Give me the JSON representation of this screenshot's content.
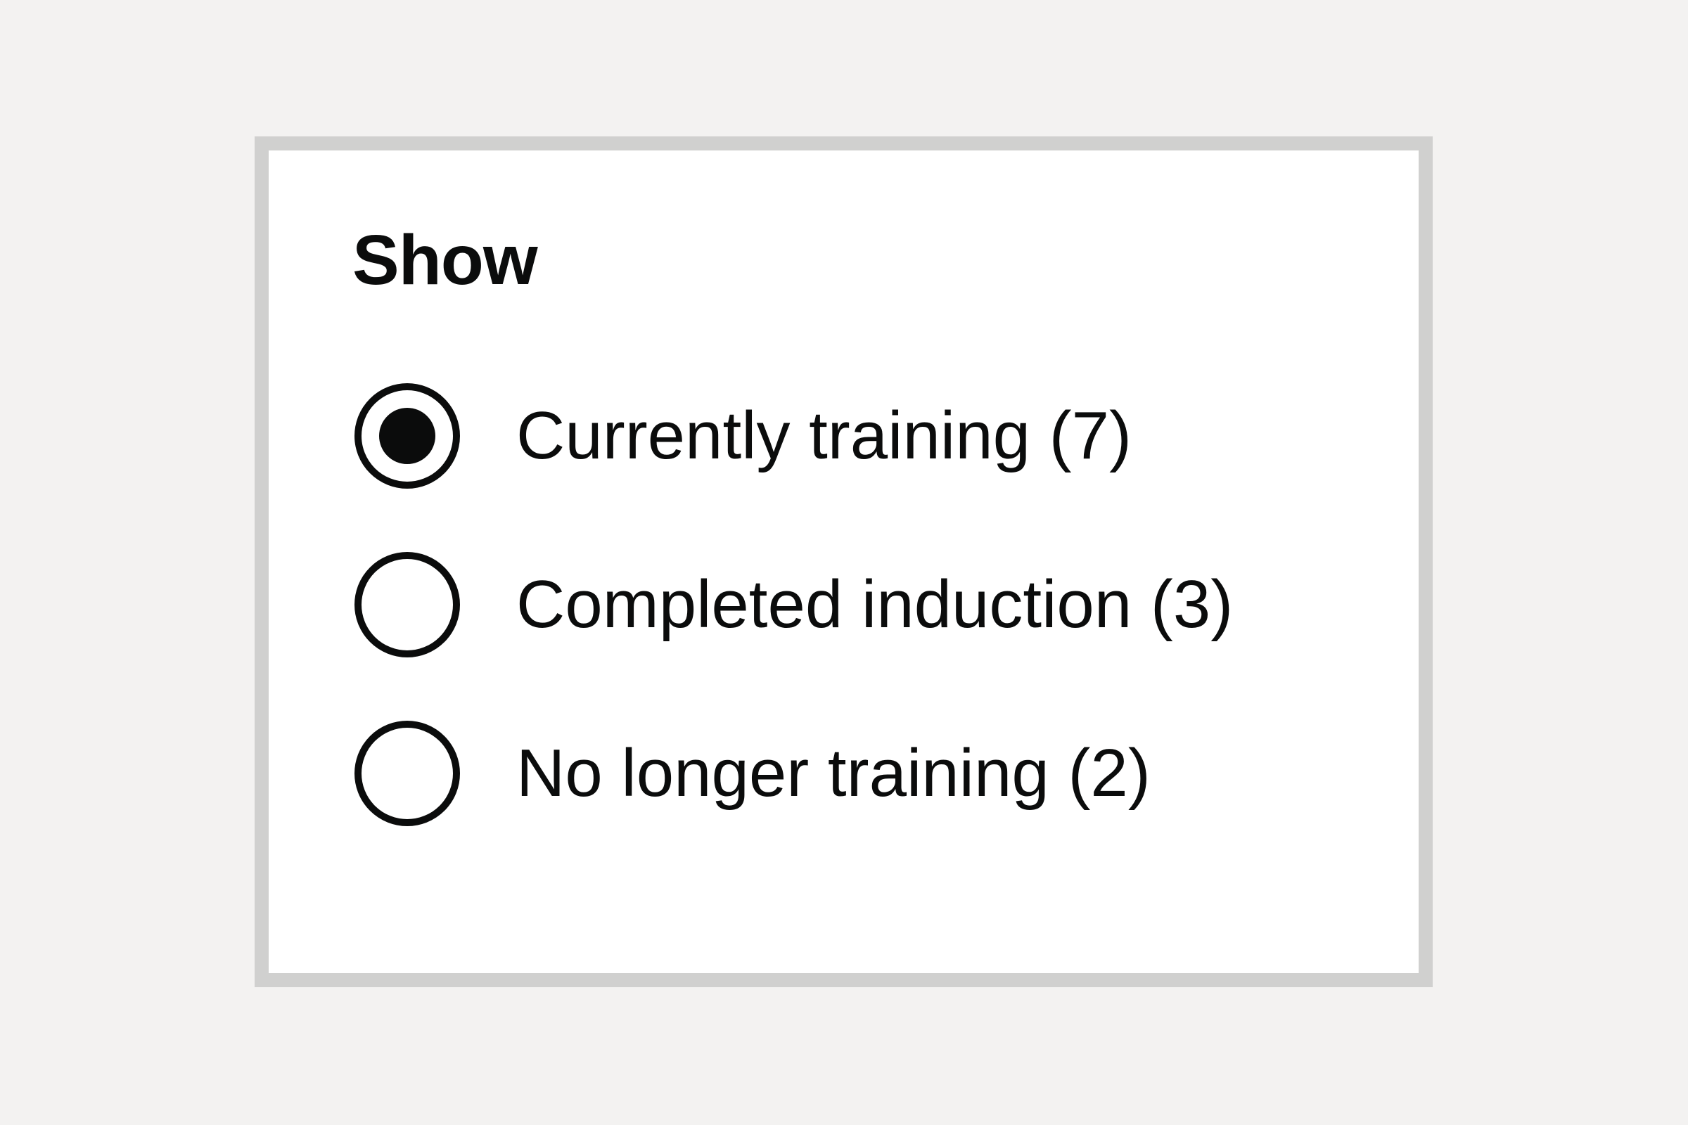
{
  "filter": {
    "legend": "Show",
    "options": [
      {
        "label": "Currently training (7)",
        "selected": true
      },
      {
        "label": "Completed induction (3)",
        "selected": false
      },
      {
        "label": "No longer training (2)",
        "selected": false
      }
    ]
  },
  "colors": {
    "page_background": "#f3f2f1",
    "panel_background": "#ffffff",
    "panel_border": "#d0d0cf",
    "text": "#0b0c0c"
  }
}
